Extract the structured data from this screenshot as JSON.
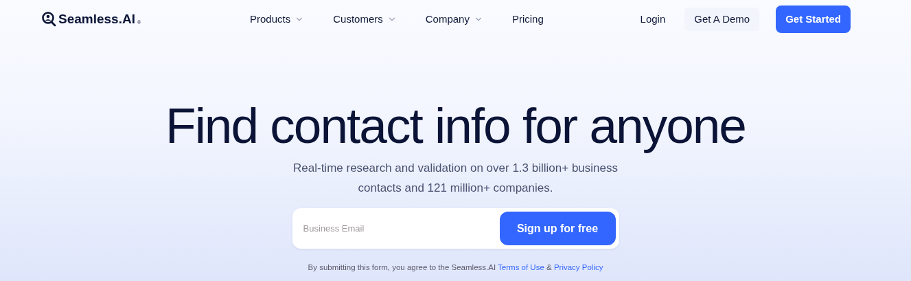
{
  "header": {
    "logo": {
      "name": "Seamless.AI",
      "mark": "®"
    },
    "nav": [
      {
        "label": "Products",
        "dropdown": true
      },
      {
        "label": "Customers",
        "dropdown": true
      },
      {
        "label": "Company",
        "dropdown": true
      },
      {
        "label": "Pricing",
        "dropdown": false
      }
    ],
    "actions": [
      {
        "label": "Login",
        "kind": "link"
      },
      {
        "label": "Get A Demo",
        "kind": "secondary"
      },
      {
        "label": "Get Started",
        "kind": "primary"
      }
    ]
  },
  "hero": {
    "headline": "Find contact info for anyone",
    "subtitle": "Real-time research and validation on over 1.3 billion+ business contacts and 121 million+ companies.",
    "form": {
      "placeholder": "Business Email",
      "button": "Sign up for free"
    },
    "consent": {
      "text": "By submitting this form, you agree to the Seamless.AI",
      "links": [
        "Terms of Use",
        "Privacy Policy"
      ],
      "joiner": "&"
    }
  }
}
